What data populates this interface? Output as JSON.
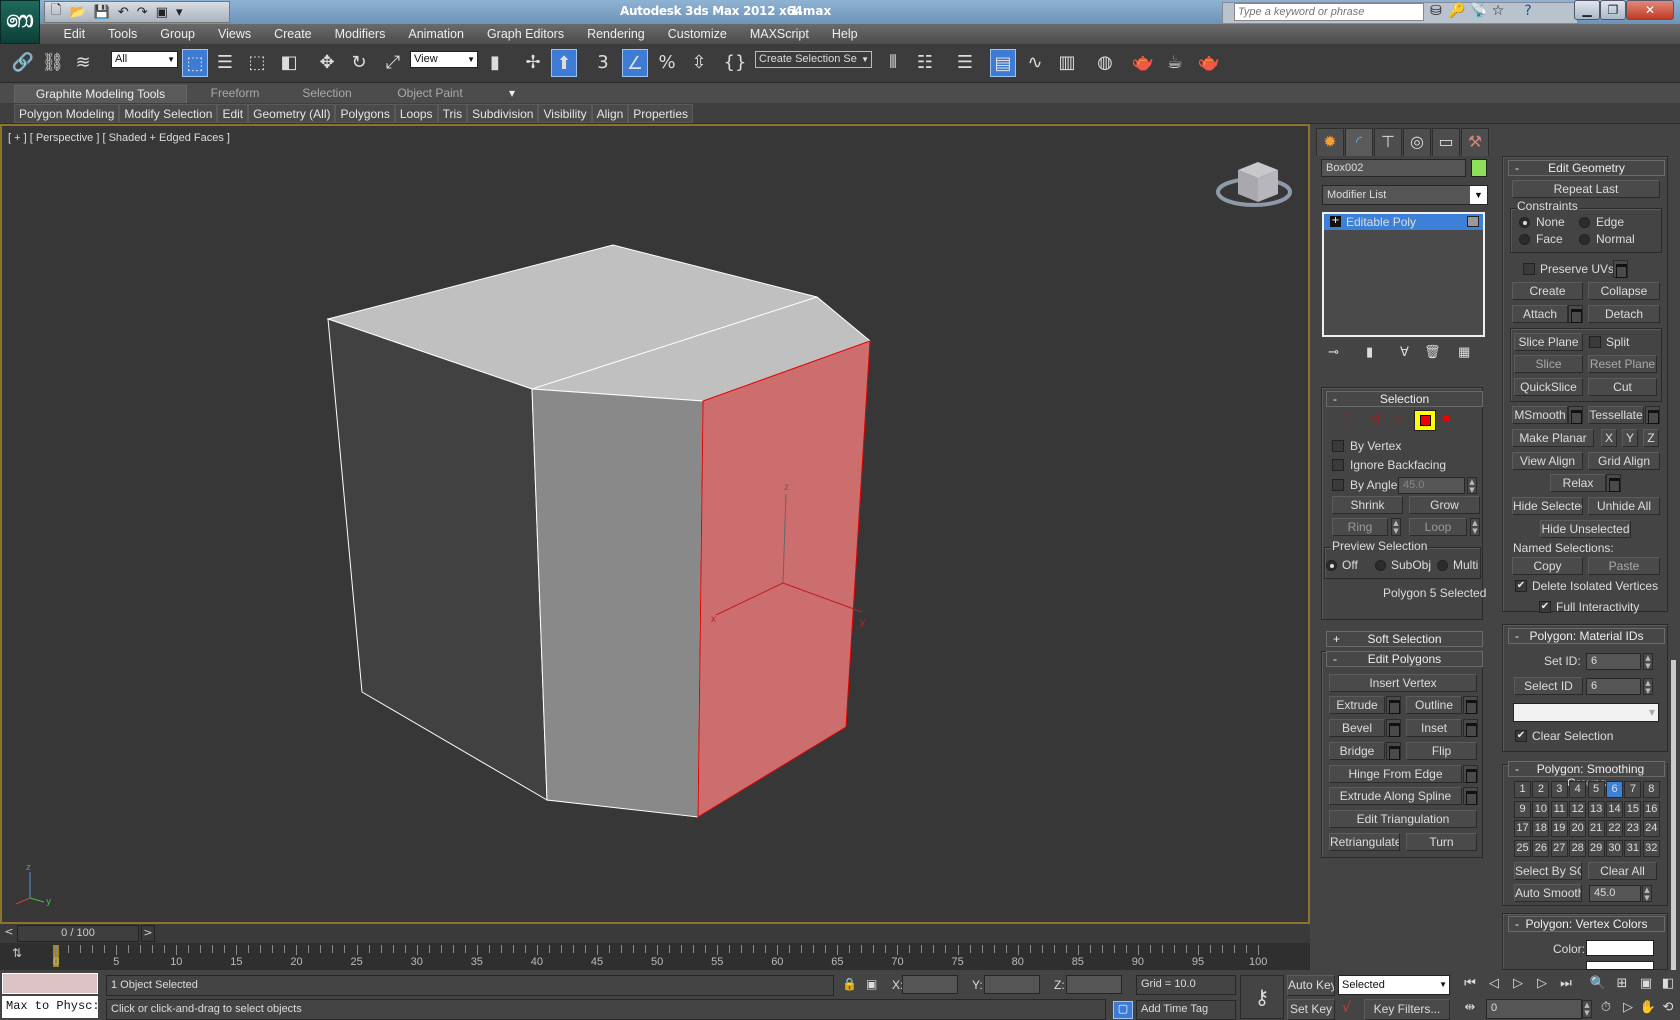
{
  "title": {
    "app": "Autodesk 3ds Max  2012 x64",
    "file": "1.max"
  },
  "search": {
    "placeholder": "Type a keyword or phrase"
  },
  "menu": [
    "Edit",
    "Tools",
    "Group",
    "Views",
    "Create",
    "Modifiers",
    "Animation",
    "Graph Editors",
    "Rendering",
    "Customize",
    "MAXScript",
    "Help"
  ],
  "toolbar": {
    "selection_filter": "All",
    "reference_coord": "View",
    "snap_value": "3",
    "named_selection": "Create Selection Se",
    "percent_snap": "%"
  },
  "ribbon": {
    "tabs": [
      "Graphite Modeling Tools",
      "Freeform",
      "Selection",
      "Object Paint"
    ],
    "panels": [
      "Polygon Modeling",
      "Modify Selection",
      "Edit",
      "Geometry (All)",
      "Polygons",
      "Loops",
      "Tris",
      "Subdivision",
      "Visibility",
      "Align",
      "Properties"
    ]
  },
  "viewport": {
    "label": "[ + ] [ Perspective ] [ Shaded + Edged Faces ]",
    "axes": {
      "x": "x",
      "y": "y",
      "z": "z"
    },
    "selected_face_color": "#cd6e6e",
    "accent_border": "#8a7430"
  },
  "command_panel": {
    "object_name": "Box002",
    "object_color": "#8ee05a",
    "modifier_list": "Modifier List",
    "stack": [
      "Editable Poly"
    ],
    "selection": {
      "title": "Selection",
      "by_vertex": "By Vertex",
      "ignore_backfacing": "Ignore Backfacing",
      "by_angle": "By Angle:",
      "angle_value": "45.0",
      "shrink": "Shrink",
      "grow": "Grow",
      "ring": "Ring",
      "loop": "Loop",
      "preview": "Preview Selection",
      "off": "Off",
      "subobj": "SubObj",
      "multi": "Multi",
      "status": "Polygon 5 Selected"
    },
    "soft_selection": "Soft Selection",
    "edit_polygons": {
      "title": "Edit Polygons",
      "insert_vertex": "Insert Vertex",
      "extrude": "Extrude",
      "outline": "Outline",
      "bevel": "Bevel",
      "inset": "Inset",
      "bridge": "Bridge",
      "flip": "Flip",
      "hinge": "Hinge From Edge",
      "extrude_spline": "Extrude Along Spline",
      "edit_tri": "Edit Triangulation",
      "retriangulate": "Retriangulate",
      "turn": "Turn"
    },
    "edit_geometry": {
      "title": "Edit Geometry",
      "repeat_last": "Repeat Last",
      "constraints": "Constraints",
      "none": "None",
      "edge": "Edge",
      "face": "Face",
      "normal": "Normal",
      "preserve_uvs": "Preserve UVs",
      "create": "Create",
      "collapse": "Collapse",
      "attach": "Attach",
      "detach": "Detach",
      "slice_plane": "Slice Plane",
      "split": "Split",
      "slice": "Slice",
      "reset_plane": "Reset Plane",
      "quickslice": "QuickSlice",
      "cut": "Cut",
      "msmooth": "MSmooth",
      "tessellate": "Tessellate",
      "make_planar": "Make Planar",
      "x": "X",
      "y": "Y",
      "z": "Z",
      "view_align": "View Align",
      "grid_align": "Grid Align",
      "relax": "Relax",
      "hide_selected": "Hide Selected",
      "unhide_all": "Unhide All",
      "hide_unselected": "Hide Unselected",
      "named_selections": "Named Selections:",
      "copy": "Copy",
      "paste": "Paste",
      "delete_isolated": "Delete Isolated Vertices",
      "full_interactivity": "Full Interactivity"
    },
    "material_ids": {
      "title": "Polygon: Material IDs",
      "set_id": "Set ID:",
      "set_id_value": "6",
      "select_id": "Select ID",
      "select_id_value": "6",
      "clear_selection": "Clear Selection"
    },
    "smoothing": {
      "title": "Polygon: Smoothing Groups",
      "groups": [
        "1",
        "2",
        "3",
        "4",
        "5",
        "6",
        "7",
        "8",
        "9",
        "10",
        "11",
        "12",
        "13",
        "14",
        "15",
        "16",
        "17",
        "18",
        "19",
        "20",
        "21",
        "22",
        "23",
        "24",
        "25",
        "26",
        "27",
        "28",
        "29",
        "30",
        "31",
        "32"
      ],
      "active": "6",
      "select_by_sg": "Select By SG",
      "clear_all": "Clear All",
      "auto_smooth": "Auto Smooth",
      "auto_smooth_value": "45.0"
    },
    "vertex_colors": {
      "title": "Polygon: Vertex Colors",
      "color": "Color:"
    }
  },
  "timeline": {
    "slider": "0 / 100",
    "labels": [
      "0",
      "5",
      "10",
      "15",
      "20",
      "25",
      "30",
      "35",
      "40",
      "45",
      "50",
      "55",
      "60",
      "65",
      "70",
      "75",
      "80",
      "85",
      "90",
      "95",
      "100"
    ]
  },
  "status": {
    "maxscript": "Max to Physc:",
    "selection": "1 Object Selected",
    "prompt": "Click or click-and-drag to select objects",
    "x_label": "X:",
    "y_label": "Y:",
    "z_label": "Z:",
    "grid": "Grid = 10.0",
    "add_time_tag": "Add Time Tag",
    "auto_key": "Auto Key",
    "set_key": "Set Key",
    "key_mode": "Selected",
    "key_filters": "Key Filters...",
    "frame": "0"
  }
}
